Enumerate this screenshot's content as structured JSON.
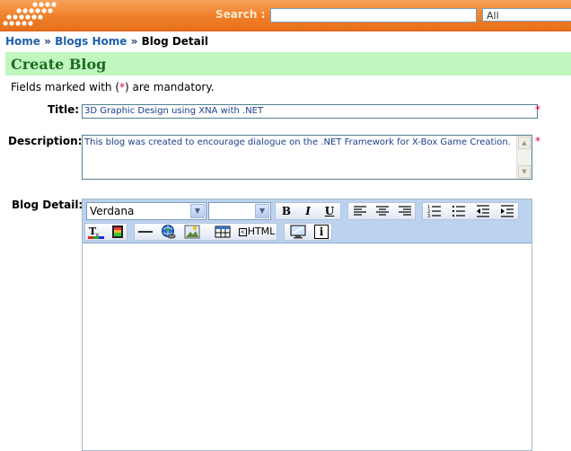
{
  "header": {
    "search_label": "Search :",
    "search_value": "",
    "search_scope": "All",
    "accent_color": "#ef7f2a"
  },
  "breadcrumb": {
    "home": "Home",
    "separator": "»",
    "blogs_home": "Blogs Home",
    "current": "Blog Detail"
  },
  "page": {
    "title": "Create Blog",
    "mandatory_prefix": "Fields marked with (",
    "mandatory_star": "*",
    "mandatory_suffix": ") are mandatory."
  },
  "form": {
    "title_label": "Title:",
    "title_value": "3D Graphic Design using XNA with .NET",
    "description_label": "Description:",
    "description_value": "This blog was created to encourage dialogue on the .NET Framework for X-Box Game Creation.",
    "blog_detail_label": "Blog Detail:",
    "required_star": "*"
  },
  "editor": {
    "font_family": "Verdana",
    "font_size": "",
    "bold": "B",
    "italic": "I",
    "underline": "U",
    "html_label": "HTML",
    "info": "i",
    "content": ""
  }
}
